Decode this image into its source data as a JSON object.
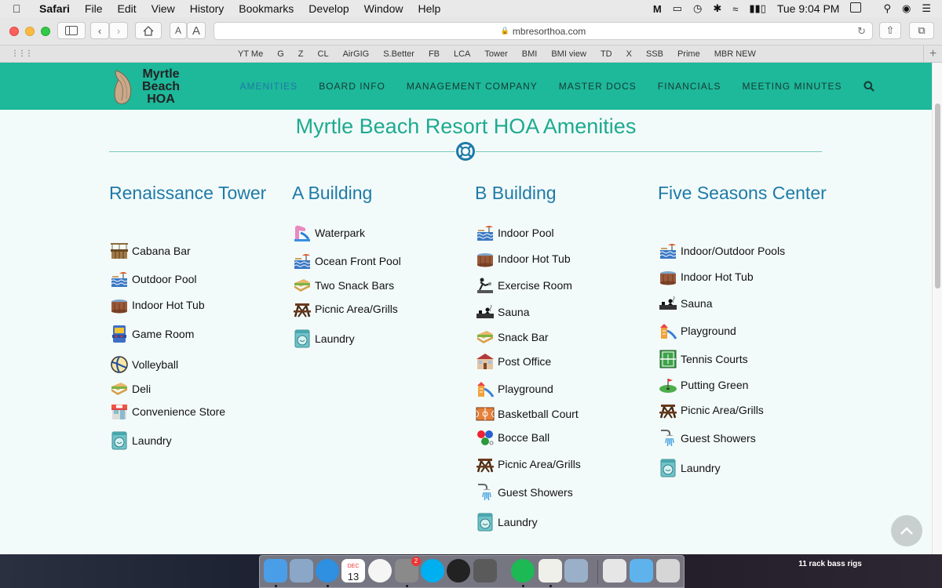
{
  "menubar": {
    "app_name": "Safari",
    "menus": [
      "File",
      "Edit",
      "View",
      "History",
      "Bookmarks",
      "Develop",
      "Window",
      "Help"
    ],
    "clock": "Tue 9:04 PM"
  },
  "browser": {
    "url": "mbresorthoa.com",
    "text_smaller": "A",
    "text_larger": "A",
    "favorites": [
      "YT Me",
      "G",
      "Z",
      "CL",
      "AirGIG",
      "S.Better",
      "FB",
      "LCA",
      "Tower",
      "BMI",
      "BMI view",
      "TD",
      "X",
      "SSB",
      "Prime",
      "MBR NEW"
    ]
  },
  "site": {
    "logo_line1": "Myrtle",
    "logo_line2": "Beach",
    "logo_line3": "HOA",
    "nav": [
      "AMENITIES",
      "BOARD INFO",
      "MANAGEMENT COMPANY",
      "MASTER DOCS",
      "FINANCIALS",
      "MEETING MINUTES"
    ],
    "active_nav": "AMENITIES",
    "page_title": "Myrtle Beach Resort HOA Amenities",
    "columns": [
      {
        "heading": "Renaissance Tower",
        "items": [
          {
            "label": "Cabana Bar",
            "icon": "cabana-bar-icon"
          },
          {
            "label": "Outdoor Pool",
            "icon": "pool-icon"
          },
          {
            "label": "Indoor Hot Tub",
            "icon": "hot-tub-icon"
          },
          {
            "label": "Game Room",
            "icon": "arcade-icon"
          },
          {
            "label": "Volleyball",
            "icon": "volleyball-icon"
          },
          {
            "label": "Deli",
            "icon": "sandwich-icon"
          },
          {
            "label": "Convenience Store",
            "icon": "store-icon"
          },
          {
            "label": "Laundry",
            "icon": "washing-machine-icon"
          }
        ]
      },
      {
        "heading": "A Building",
        "items": [
          {
            "label": "Waterpark",
            "icon": "waterpark-icon"
          },
          {
            "label": "Ocean Front Pool",
            "icon": "pool-icon"
          },
          {
            "label": "Two Snack Bars",
            "icon": "sandwich-icon"
          },
          {
            "label": "Picnic Area/Grills",
            "icon": "picnic-table-icon"
          },
          {
            "label": "Laundry",
            "icon": "washing-machine-icon"
          }
        ]
      },
      {
        "heading": "B Building",
        "items": [
          {
            "label": "Indoor Pool",
            "icon": "pool-icon"
          },
          {
            "label": "Indoor Hot Tub",
            "icon": "hot-tub-icon"
          },
          {
            "label": "Exercise Room",
            "icon": "exercise-icon"
          },
          {
            "label": "Sauna",
            "icon": "sauna-icon"
          },
          {
            "label": "Snack Bar",
            "icon": "sandwich-icon"
          },
          {
            "label": "Post Office",
            "icon": "post-office-icon"
          },
          {
            "label": "Playground",
            "icon": "playground-icon"
          },
          {
            "label": "Basketball Court",
            "icon": "basketball-court-icon"
          },
          {
            "label": "Bocce Ball",
            "icon": "bocce-ball-icon"
          },
          {
            "label": "Picnic Area/Grills",
            "icon": "picnic-table-icon"
          },
          {
            "label": "Guest Showers",
            "icon": "shower-icon"
          },
          {
            "label": "Laundry",
            "icon": "washing-machine-icon"
          }
        ]
      },
      {
        "heading": "Five Seasons Center",
        "items": [
          {
            "label": "Indoor/Outdoor Pools",
            "icon": "pool-icon"
          },
          {
            "label": "Indoor Hot Tub",
            "icon": "hot-tub-icon"
          },
          {
            "label": "Sauna",
            "icon": "sauna-icon"
          },
          {
            "label": "Playground",
            "icon": "playground-icon"
          },
          {
            "label": "Tennis Courts",
            "icon": "tennis-court-icon"
          },
          {
            "label": "Putting Green",
            "icon": "putting-green-icon"
          },
          {
            "label": "Picnic Area/Grills",
            "icon": "picnic-table-icon"
          },
          {
            "label": "Guest Showers",
            "icon": "shower-icon"
          },
          {
            "label": "Laundry",
            "icon": "washing-machine-icon"
          }
        ]
      }
    ]
  },
  "dock": {
    "apps": [
      "finder-icon",
      "preview-icon",
      "safari-icon",
      "calendar-icon",
      "photos-icon",
      "system-preferences-icon",
      "skype-icon",
      "logic-icon",
      "calculator-icon",
      "spotify-icon",
      "textedit-icon",
      "image-capture-icon",
      "documents-stack-icon",
      "folder-icon",
      "trash-icon"
    ],
    "calendar_day": "13",
    "calendar_month": "DEC",
    "prefs_badge": "2"
  },
  "desktop_note": "11 rack bass rigs",
  "colors": {
    "header_teal": "#1eb89a",
    "title_teal": "#1eaa90",
    "heading_blue": "#1e7aa8",
    "page_bg": "#f3fbfa"
  }
}
